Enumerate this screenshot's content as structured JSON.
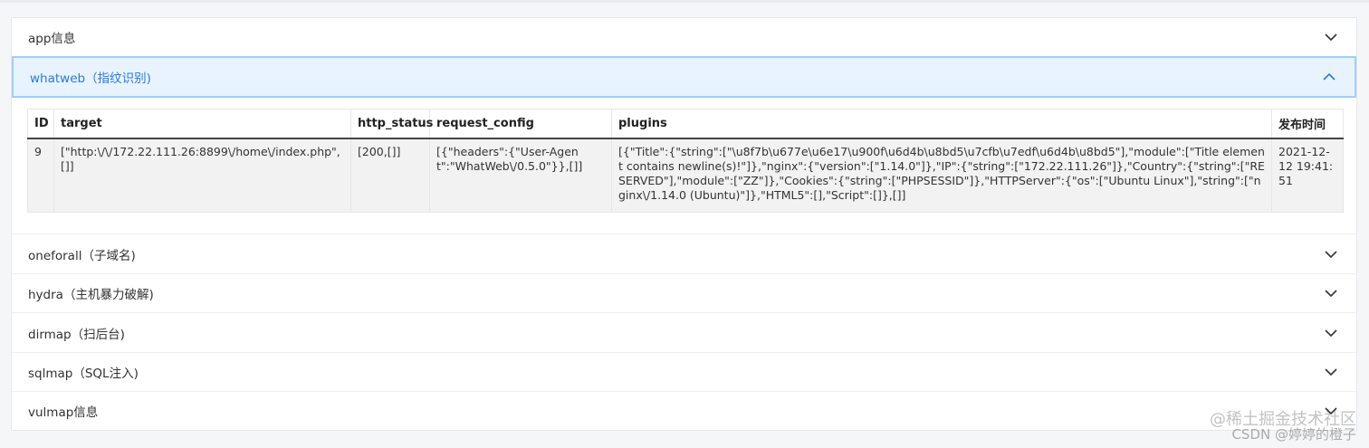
{
  "accordion": [
    {
      "label": "app信息",
      "expanded": false
    },
    {
      "label": "whatweb（指纹识别)",
      "expanded": true
    },
    {
      "label": "oneforall（子域名)",
      "expanded": false
    },
    {
      "label": "hydra（主机暴力破解)",
      "expanded": false
    },
    {
      "label": "dirmap（扫后台)",
      "expanded": false
    },
    {
      "label": "sqlmap（SQL注入)",
      "expanded": false
    },
    {
      "label": "vulmap信息",
      "expanded": false
    }
  ],
  "icons": {
    "collapsed": "chevron-down-icon",
    "expanded": "chevron-up-icon"
  },
  "table": {
    "headers": [
      "ID",
      "target",
      "http_status",
      "request_config",
      "plugins",
      "发布时间"
    ],
    "rows": [
      {
        "id": "9",
        "target": "[\"http:\\/\\/172.22.111.26:8899\\/home\\/index.php\", []]",
        "http_status": "[200,[]]",
        "request_config": "[{\"headers\":{\"User-Agent\":\"WhatWeb\\/0.5.0\"}},[]]",
        "plugins": "[{\"Title\":{\"string\":[\"\\u8f7b\\u677e\\u6e17\\u900f\\u6d4b\\u8bd5\\u7cfb\\u7edf\\u6d4b\\u8bd5\"],\"module\":[\"Title element contains newline(s)!\"]},\"nginx\":{\"version\":[\"1.14.0\"]},\"IP\":{\"string\":[\"172.22.111.26\"]},\"Country\":{\"string\":[\"RESERVED\"],\"module\":[\"ZZ\"]},\"Cookies\":{\"string\":[\"PHPSESSID\"]},\"HTTPServer\":{\"os\":[\"Ubuntu Linux\"],\"string\":[\"nginx\\/1.14.0 (Ubuntu)\"]},\"HTML5\":[],\"Script\":[]},[]]",
        "time": "2021-12-12 19:41:51"
      }
    ]
  },
  "colors": {
    "accent": "#2a7bd6",
    "active_bg": "#e8f3fe",
    "active_border": "#a4cdf6"
  },
  "watermark": {
    "line1": "@稀土掘金技术社区",
    "line2": "CSDN @婷婷的橙子"
  }
}
